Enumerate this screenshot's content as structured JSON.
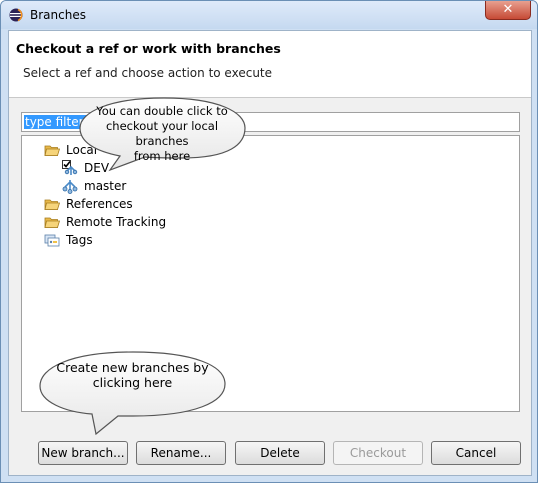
{
  "window": {
    "title": "Branches",
    "app_icon": "eclipse-icon"
  },
  "header": {
    "title": "Checkout a ref or work with branches",
    "subtitle": "Select a ref and choose action to execute"
  },
  "filter": {
    "value": "type filter text",
    "visible_value": "type filter t"
  },
  "tree": {
    "local": {
      "label": "Local",
      "icon": "folder-open-icon"
    },
    "dev": {
      "label": "DEV",
      "icon": "branch-checked-out-icon"
    },
    "master": {
      "label": "master",
      "icon": "branch-icon"
    },
    "references": {
      "label": "References",
      "icon": "folder-icon"
    },
    "remote": {
      "label": "Remote Tracking",
      "icon": "folder-icon"
    },
    "tags": {
      "label": "Tags",
      "icon": "tags-icon"
    }
  },
  "callouts": {
    "top_line1": "You can double click to",
    "top_line2": "checkout your local branches",
    "top_line3": "from here",
    "bottom_line1": "Create new branches by",
    "bottom_line2": "clicking here"
  },
  "buttons": {
    "new_branch": "New branch...",
    "rename": "Rename...",
    "delete": "Delete",
    "checkout": "Checkout",
    "cancel": "Cancel"
  },
  "colors": {
    "selection": "#3399ff",
    "folder": "#f0c24a",
    "branch": "#4a8ac8"
  }
}
